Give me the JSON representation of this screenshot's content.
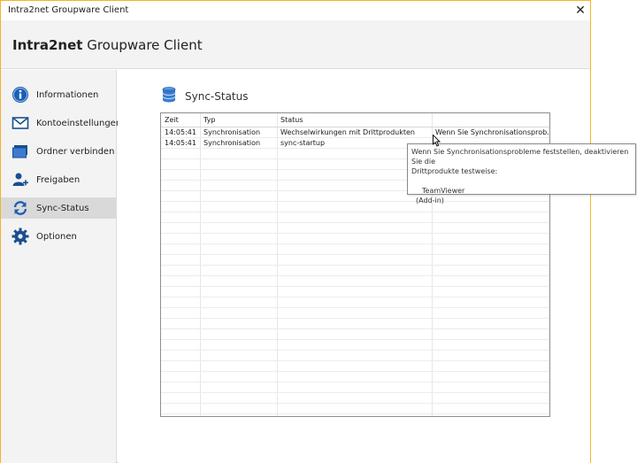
{
  "window": {
    "title": "Intra2net Groupware Client",
    "close_glyph": "✕"
  },
  "header": {
    "brand_bold": "Intra2net",
    "brand_rest": " Groupware Client"
  },
  "sidebar": {
    "items": [
      {
        "label": "Informationen",
        "icon": "info-icon",
        "active": false
      },
      {
        "label": "Kontoeinstellungen",
        "icon": "mail-icon",
        "active": false
      },
      {
        "label": "Ordner verbinden",
        "icon": "folder-icon",
        "active": false
      },
      {
        "label": "Freigaben",
        "icon": "share-user-icon",
        "active": false
      },
      {
        "label": "Sync-Status",
        "icon": "sync-icon",
        "active": true
      },
      {
        "label": "Optionen",
        "icon": "gear-icon",
        "active": false
      }
    ]
  },
  "main": {
    "title": "Sync-Status",
    "title_icon": "database-icon",
    "table": {
      "columns": [
        "Zeit",
        "Typ",
        "Status",
        ""
      ],
      "rows": [
        [
          "14:05:41",
          "Synchronisation",
          "Wechselwirkungen mit Drittprodukten",
          "Wenn Sie Synchronisationsprob..."
        ],
        [
          "14:05:41",
          "Synchronisation",
          "sync-startup",
          ""
        ]
      ]
    },
    "tooltip": {
      "line1": "Wenn Sie Synchronisationsprobleme feststellen, deaktivieren Sie die",
      "line2": "Drittprodukte testweise:",
      "item": "TeamViewer",
      "item_sub": "(Add-in)"
    }
  },
  "colors": {
    "accent_blue": "#1a5fb4",
    "window_border": "#f0b429",
    "sidebar_bg": "#f3f3f3",
    "active_bg": "#d9d9d9"
  }
}
